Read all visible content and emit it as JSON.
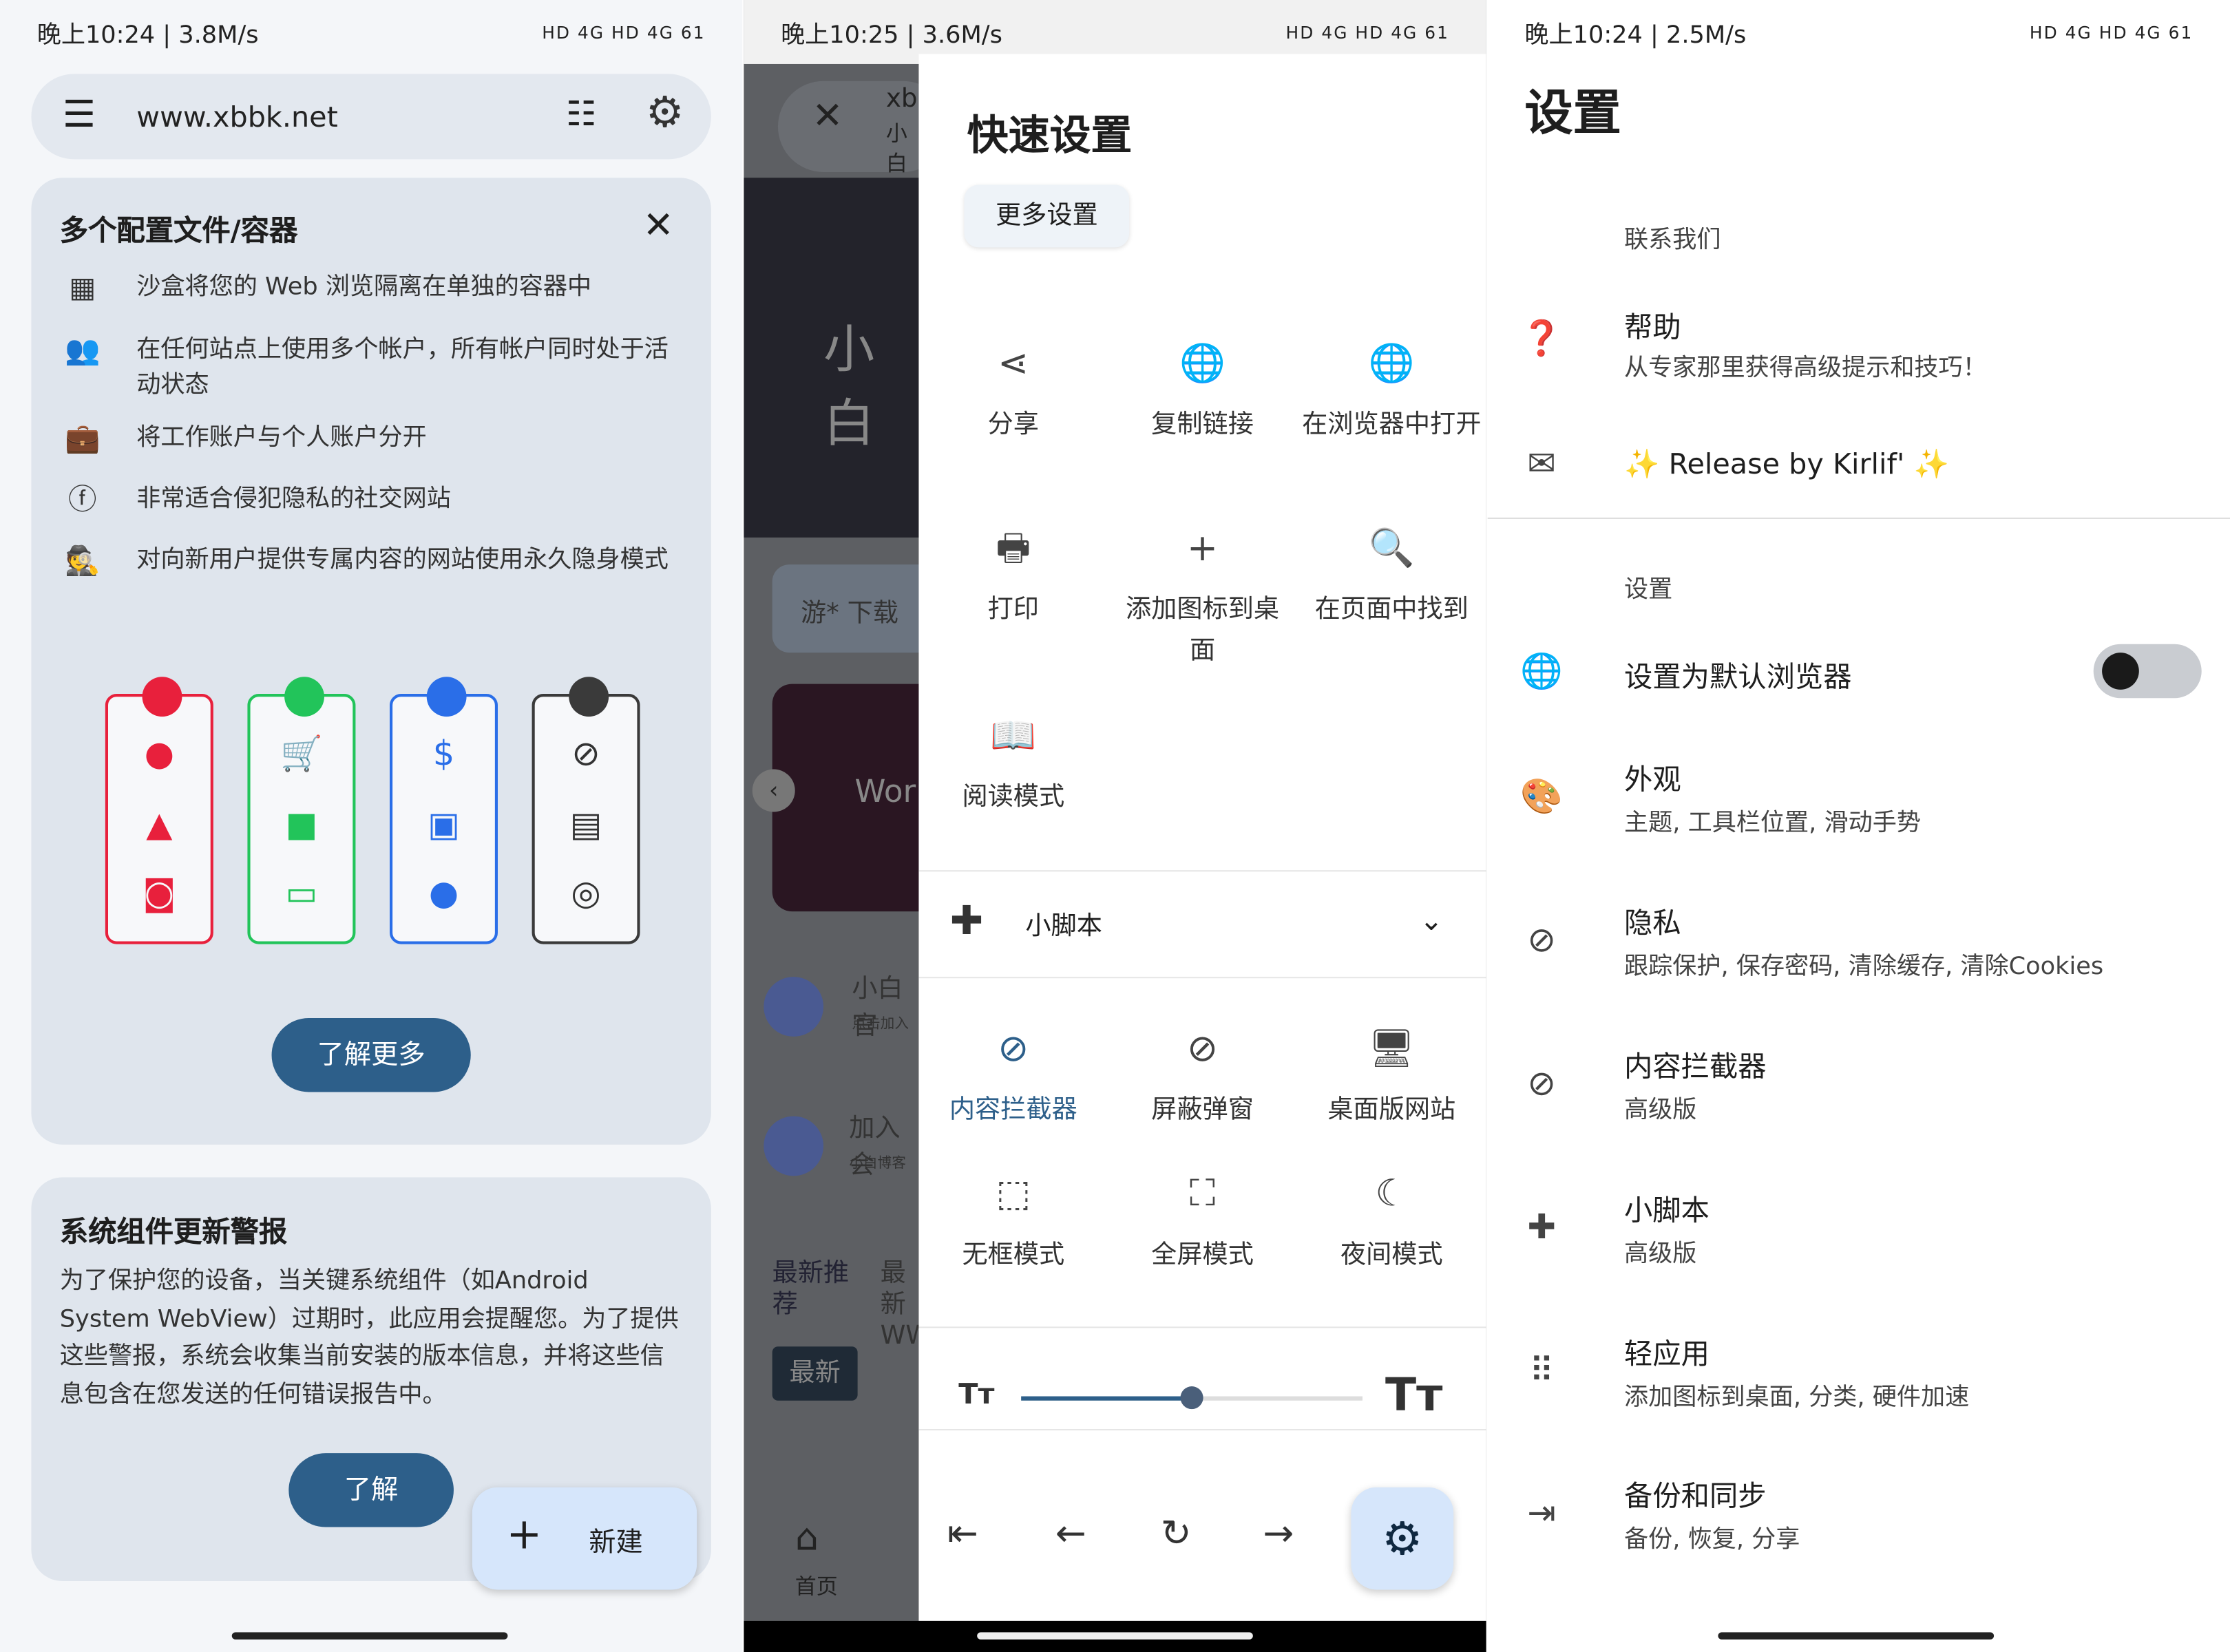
{
  "left": {
    "status": {
      "time": "晚上10:24 | 3.8M/s",
      "right": "HD 4G HD 4G 61"
    },
    "url": "www.xbbk.net",
    "card1": {
      "title": "多个配置文件/容器",
      "features": [
        {
          "icon": "grid-icon",
          "text": "沙盒将您的 Web 浏览隔离在单独的容器中"
        },
        {
          "icon": "people-icon",
          "text": "在任何站点上使用多个帐户，所有帐户同时处于活动状态"
        },
        {
          "icon": "briefcase-icon",
          "text": "将工作账户与个人账户分开"
        },
        {
          "icon": "facebook-icon",
          "text": "非常适合侵犯隐私的社交网站"
        },
        {
          "icon": "incognito-icon",
          "text": "对向新用户提供专属内容的网站使用永久隐身模式"
        }
      ],
      "containers": [
        {
          "color": "#e8203c",
          "icons": [
            "💬",
            "👍",
            "📷"
          ]
        },
        {
          "color": "#22c45a",
          "icons": [
            "🛒",
            "🎁",
            "💵"
          ]
        },
        {
          "color": "#2a6ee8",
          "icons": [
            "$",
            "💴",
            "🐷"
          ]
        },
        {
          "color": "#3a3a3a",
          "icons": [
            "◎",
            "▦",
            "◉"
          ]
        }
      ],
      "button": "了解更多"
    },
    "card2": {
      "title": "系统组件更新警报",
      "body": "为了保护您的设备，当关键系统组件（如Android System WebView）过期时，此应用会提醒您。为了提供这些警报，系统会收集当前安装的版本信息，并将这些信息包含在您发送的任何错误报告中。",
      "button": "了解"
    },
    "fab": "新建"
  },
  "middle": {
    "status": {
      "time": "晚上10:25 | 3.6M/s",
      "right": "HD 4G HD 4G 61"
    },
    "background": {
      "tab_title": "xbl",
      "tab_sub": "小白",
      "hero": "小白",
      "banner": "游* 下载",
      "slide": "Wor",
      "item1": "小白官",
      "item1_sub": "点击加入",
      "item2": "加入会",
      "item2_sub": "小白博客",
      "tab_a": "最新推荐",
      "tab_b": "最新WW",
      "chip": "最新",
      "home": "首页"
    },
    "title": "快速设置",
    "more_settings": "更多设置",
    "actions": [
      {
        "icon": "share-icon",
        "label": "分享"
      },
      {
        "icon": "globe-icon",
        "label": "复制链接"
      },
      {
        "icon": "globe-icon",
        "label": "在浏览器中打开"
      },
      {
        "icon": "print-icon",
        "label": "打印"
      },
      {
        "icon": "plus-icon",
        "label": "添加图标到桌面"
      },
      {
        "icon": "search-icon",
        "label": "在页面中找到"
      },
      {
        "icon": "book-icon",
        "label": "阅读模式"
      }
    ],
    "scripts": "小脚本",
    "toggles": [
      {
        "icon": "eye-off-icon",
        "label": "内容拦截器",
        "active": true
      },
      {
        "icon": "eye-off-icon",
        "label": "屏蔽弹窗",
        "active": false
      },
      {
        "icon": "monitor-icon",
        "label": "桌面版网站",
        "active": false
      },
      {
        "icon": "frame-icon",
        "label": "无框模式",
        "active": false
      },
      {
        "icon": "fullscreen-icon",
        "label": "全屏模式",
        "active": false
      },
      {
        "icon": "night-icon",
        "label": "夜间模式",
        "active": false
      }
    ],
    "text_size_percent": 50,
    "accent": "#2d5f8a"
  },
  "right": {
    "status": {
      "time": "晚上10:24 | 2.5M/s",
      "right": "HD 4G HD 4G 61"
    },
    "title": "设置",
    "section_contact": "联系我们",
    "help": {
      "title": "帮助",
      "sub": "从专家那里获得高级提示和技巧！"
    },
    "release": "✨ Release by Kirlif' ✨",
    "section_settings": "设置",
    "default_browser": {
      "title": "设置为默认浏览器",
      "on": false
    },
    "items": [
      {
        "icon": "palette-icon",
        "title": "外观",
        "sub": "主题, 工具栏位置, 滑动手势"
      },
      {
        "icon": "eye-off-icon",
        "title": "隐私",
        "sub": "跟踪保护, 保存密码, 清除缓存, 清除Cookies"
      },
      {
        "icon": "eye-off-icon",
        "title": "内容拦截器",
        "sub": "高级版"
      },
      {
        "icon": "puzzle-icon",
        "title": "小脚本",
        "sub": "高级版"
      },
      {
        "icon": "apps-icon",
        "title": "轻应用",
        "sub": "添加图标到桌面, 分类, 硬件加速"
      },
      {
        "icon": "export-icon",
        "title": "备份和同步",
        "sub": "备份, 恢复, 分享"
      }
    ]
  }
}
